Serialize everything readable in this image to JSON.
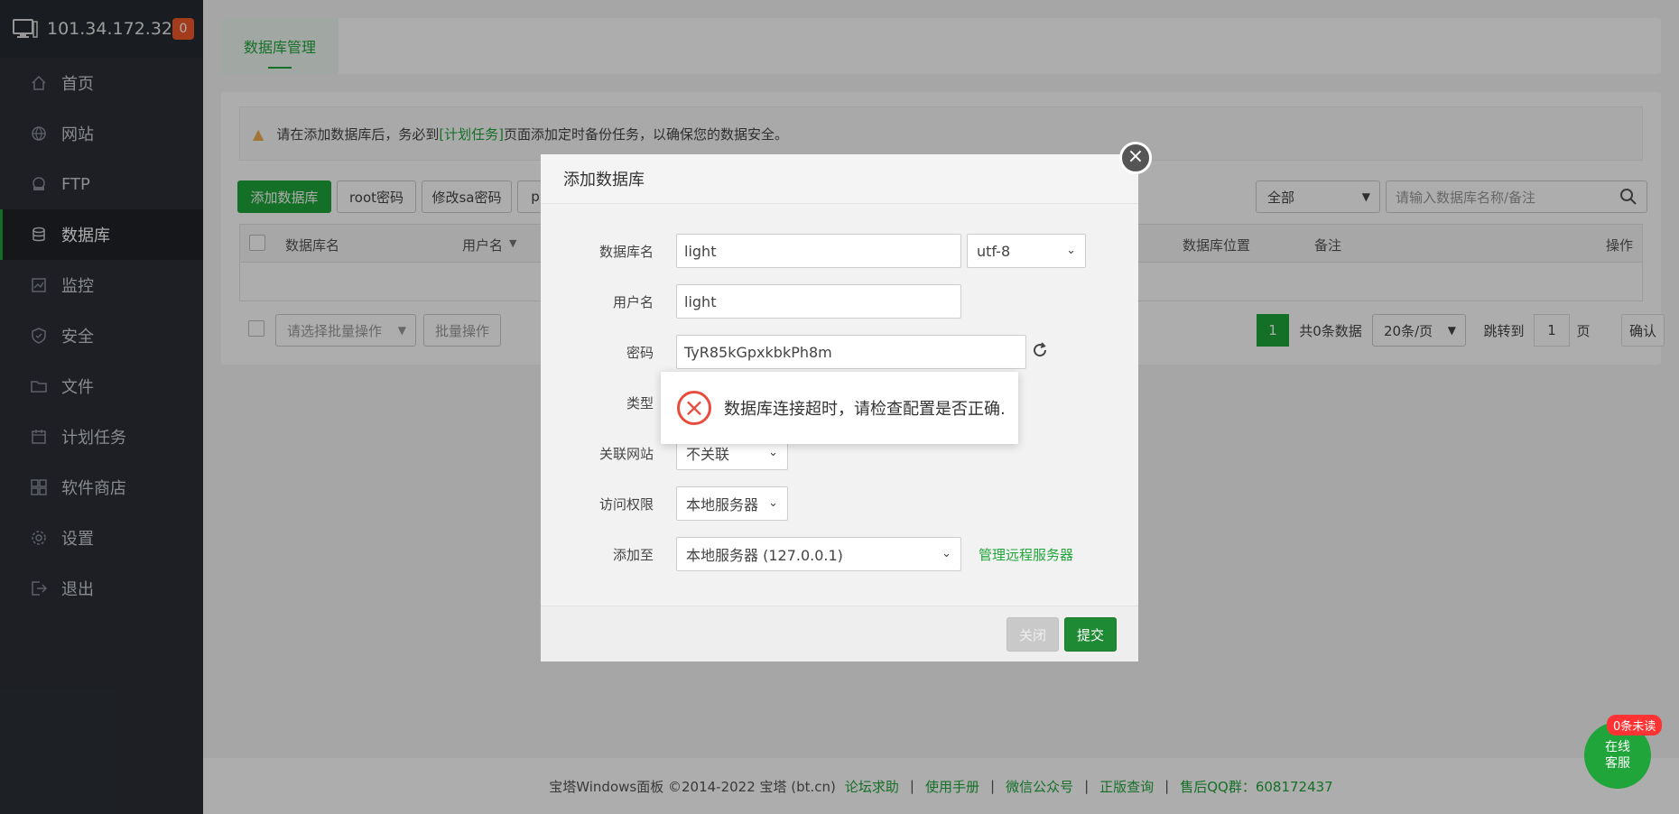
{
  "sidebar": {
    "ip": "101.34.172.32",
    "badge": "0",
    "items": [
      {
        "label": "首页",
        "icon": "home-icon"
      },
      {
        "label": "网站",
        "icon": "globe-icon"
      },
      {
        "label": "FTP",
        "icon": "ftp-icon"
      },
      {
        "label": "数据库",
        "icon": "database-icon"
      },
      {
        "label": "监控",
        "icon": "monitor-icon"
      },
      {
        "label": "安全",
        "icon": "shield-icon"
      },
      {
        "label": "文件",
        "icon": "folder-icon"
      },
      {
        "label": "计划任务",
        "icon": "calendar-icon"
      },
      {
        "label": "软件商店",
        "icon": "apps-icon"
      },
      {
        "label": "设置",
        "icon": "gear-icon"
      },
      {
        "label": "退出",
        "icon": "logout-icon"
      }
    ]
  },
  "tab": "数据库管理",
  "alert": {
    "prefix": "请在添加数据库后，务必到",
    "link": "[计划任务]",
    "suffix": "页面添加定时备份任务，以确保您的数据安全。"
  },
  "toolbar": {
    "add_db": "添加数据库",
    "root_pwd": "root密码",
    "sa_pwd": "修改sa密码",
    "partial": "p",
    "filter": "全部",
    "search_placeholder": "请输入数据库名称/备注"
  },
  "table": {
    "cols": [
      "数据库名",
      "用户名",
      "数据库位置",
      "备注",
      "操作"
    ]
  },
  "bulk": {
    "select": "请选择批量操作",
    "button": "批量操作"
  },
  "pagination": {
    "page": "1",
    "total": "共0条数据",
    "per_page": "20条/页",
    "goto": "跳转到",
    "goto_value": "1",
    "unit": "页",
    "confirm": "确认"
  },
  "modal": {
    "title": "添加数据库",
    "fields": {
      "dbname_label": "数据库名",
      "dbname_value": "light",
      "charset": "utf-8",
      "user_label": "用户名",
      "user_value": "light",
      "pwd_label": "密码",
      "pwd_value": "TyR85kGpxkbkPh8m",
      "type_label": "类型",
      "site_label": "关联网站",
      "site_value": "不关联",
      "access_label": "访问权限",
      "access_value": "本地服务器",
      "addto_label": "添加至",
      "addto_value": "本地服务器 (127.0.0.1)",
      "manage_remote": "管理远程服务器"
    },
    "close_btn": "关闭",
    "submit_btn": "提交"
  },
  "toast": "数据库连接超时，请检查配置是否正确.",
  "footer": {
    "copyright": "宝塔Windows面板 ©2014-2022 宝塔 (bt.cn)",
    "links": [
      "论坛求助",
      "使用手册",
      "微信公众号",
      "正版查询"
    ],
    "qq": "售后QQ群：608172437"
  },
  "chat": {
    "badge": "0条未读",
    "line1": "在线",
    "line2": "客服"
  }
}
